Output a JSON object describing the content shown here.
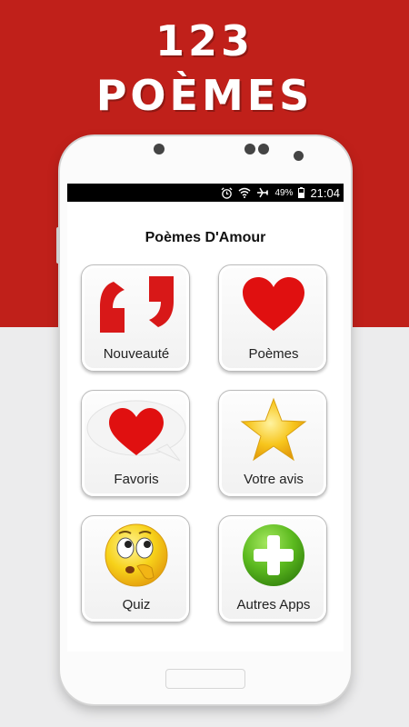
{
  "promo": {
    "line1": "123",
    "line2": "POÈMES"
  },
  "statusbar": {
    "battery": "49%",
    "time": "21:04"
  },
  "app": {
    "title": "Poèmes D'Amour"
  },
  "menu": [
    {
      "label": "Nouveauté",
      "icon": "quote-icon"
    },
    {
      "label": "Poèmes",
      "icon": "heart-icon"
    },
    {
      "label": "Favoris",
      "icon": "heart-bubble-icon"
    },
    {
      "label": "Votre avis",
      "icon": "star-icon"
    },
    {
      "label": "Quiz",
      "icon": "thinking-smiley-icon"
    },
    {
      "label": "Autres Apps",
      "icon": "plus-circle-icon"
    }
  ],
  "colors": {
    "brand_red": "#c0201a",
    "icon_red": "#d81818",
    "star_gold": "#f7c51c",
    "plus_green": "#5cba1f"
  }
}
